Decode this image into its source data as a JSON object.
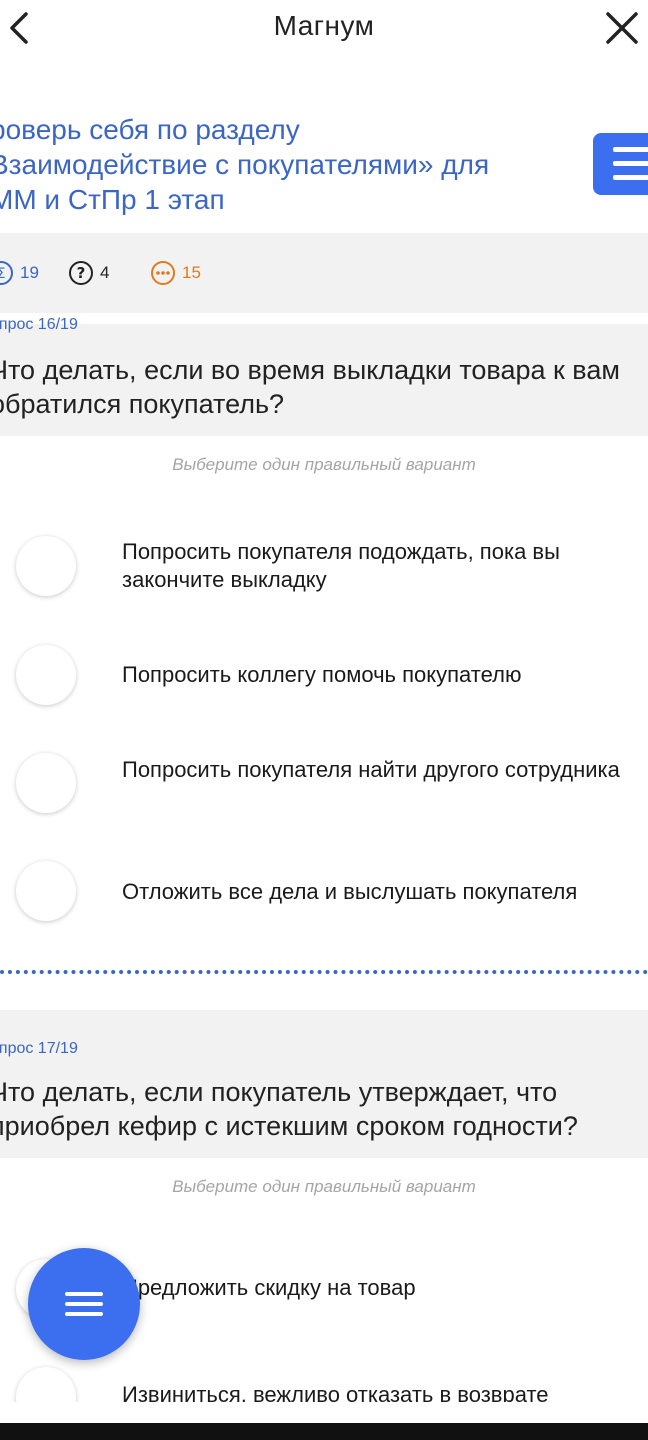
{
  "header": {
    "title": "Магнум"
  },
  "test": {
    "title": "роверь себя по разделу\nВзаимодействие с покупателями» для\nММ и СтПр 1 этап"
  },
  "stats": {
    "total": "19",
    "unanswered": "4",
    "remaining": "15"
  },
  "questions": [
    {
      "number": "опрос 16/19",
      "text": "Что делать, если во время выкладки товара к вам обратился покупатель?",
      "hint": "Выберите один правильный вариант",
      "options": [
        "Попросить покупателя подождать, пока вы закончите выкладку",
        "Попросить коллегу помочь покупателю",
        "Попросить покупателя найти другого сотрудника",
        "Отложить все дела и выслушать покупателя"
      ]
    },
    {
      "number": "опрос 17/19",
      "text": "Что делать, если покупатель утверждает, что приобрел кефир с истекшим сроком годности?",
      "hint": "Выберите один правильный вариант",
      "options": [
        "Предложить скидку на товар",
        "Извиниться, вежливо отказать в возврате"
      ]
    }
  ],
  "colors": {
    "accent": "#3b6ff0",
    "link_text": "#3b66c4",
    "panel_bg": "#f2f2f2"
  }
}
